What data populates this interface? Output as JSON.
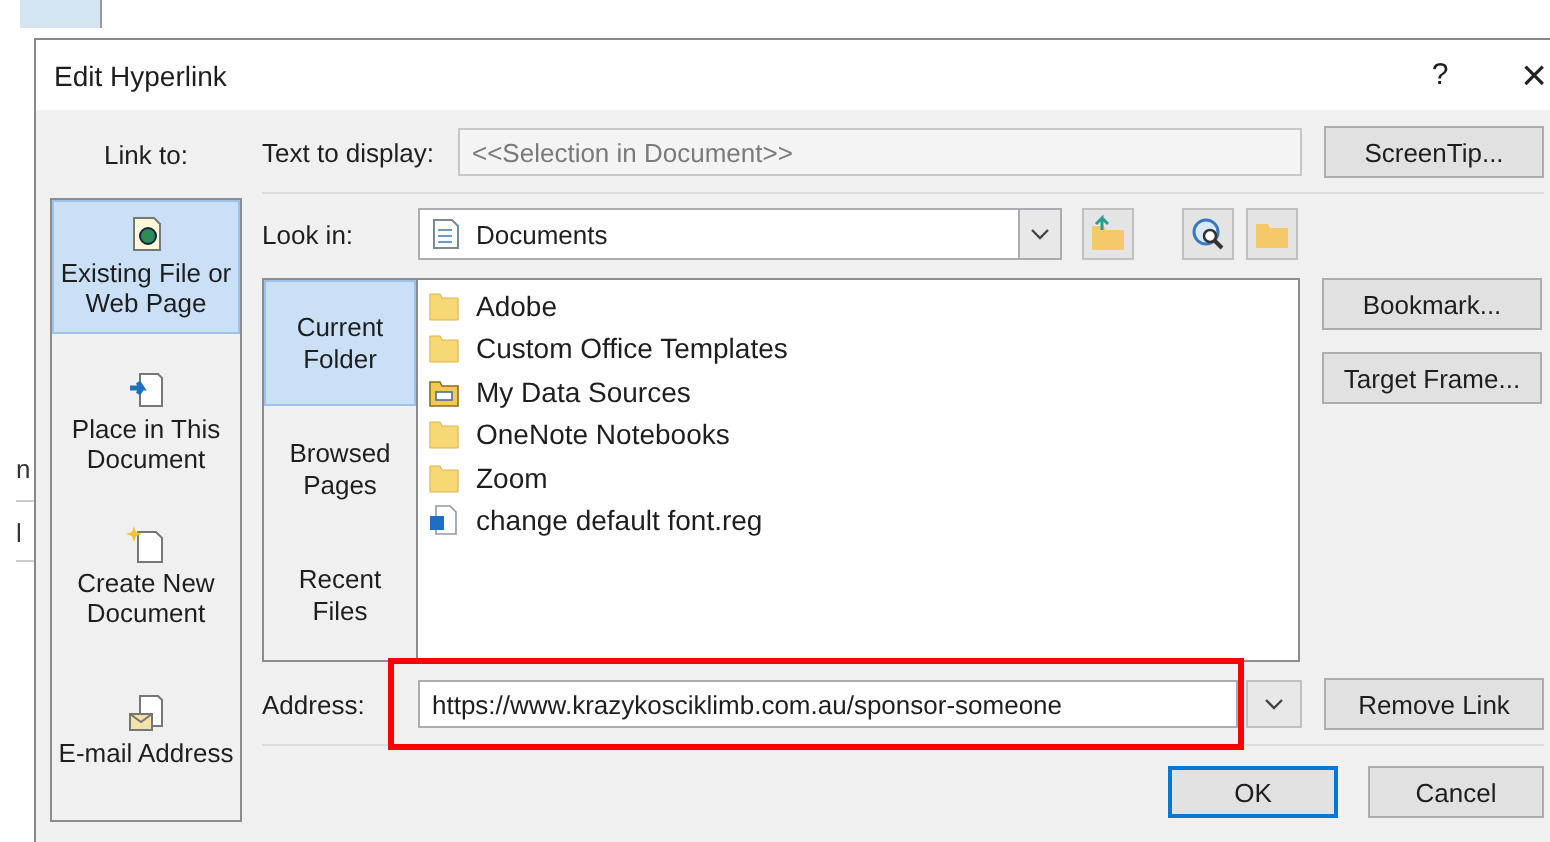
{
  "background_fragments": [
    "n",
    "l"
  ],
  "window": {
    "title": "Edit Hyperlink",
    "help": "?",
    "close": "×"
  },
  "link_to": {
    "label": "Link to:",
    "items": [
      {
        "kind": "web-file",
        "label": "Existing File or Web Page",
        "selected": true
      },
      {
        "kind": "place",
        "label": "Place in This Document",
        "selected": false
      },
      {
        "kind": "new-doc",
        "label": "Create New Document",
        "selected": false
      },
      {
        "kind": "email",
        "label": "E-mail Address",
        "selected": false
      }
    ]
  },
  "text_to_display": {
    "label": "Text to display:",
    "value": "<<Selection in Document>>",
    "disabled": true
  },
  "screentip_button": "ScreenTip...",
  "look_in": {
    "label": "Look in:",
    "value": "Documents"
  },
  "browse_tabs": [
    {
      "label": "Current Folder",
      "selected": true
    },
    {
      "label": "Browsed Pages",
      "selected": false
    },
    {
      "label": "Recent Files",
      "selected": false
    }
  ],
  "files": [
    {
      "kind": "folder",
      "name": "Adobe"
    },
    {
      "kind": "folder",
      "name": "Custom Office Templates"
    },
    {
      "kind": "special-folder",
      "name": "My Data Sources"
    },
    {
      "kind": "folder",
      "name": "OneNote Notebooks"
    },
    {
      "kind": "folder",
      "name": "Zoom"
    },
    {
      "kind": "reg-file",
      "name": "change default font.reg"
    }
  ],
  "side_buttons": [
    "Bookmark...",
    "Target Frame..."
  ],
  "address": {
    "label": "Address:",
    "value": "https://www.krazykosciklimb.com.au/sponsor-someone",
    "highlighted": true
  },
  "remove_link_button": "Remove Link",
  "buttons": [
    {
      "label": "OK",
      "default": true
    },
    {
      "label": "Cancel",
      "default": false
    }
  ]
}
